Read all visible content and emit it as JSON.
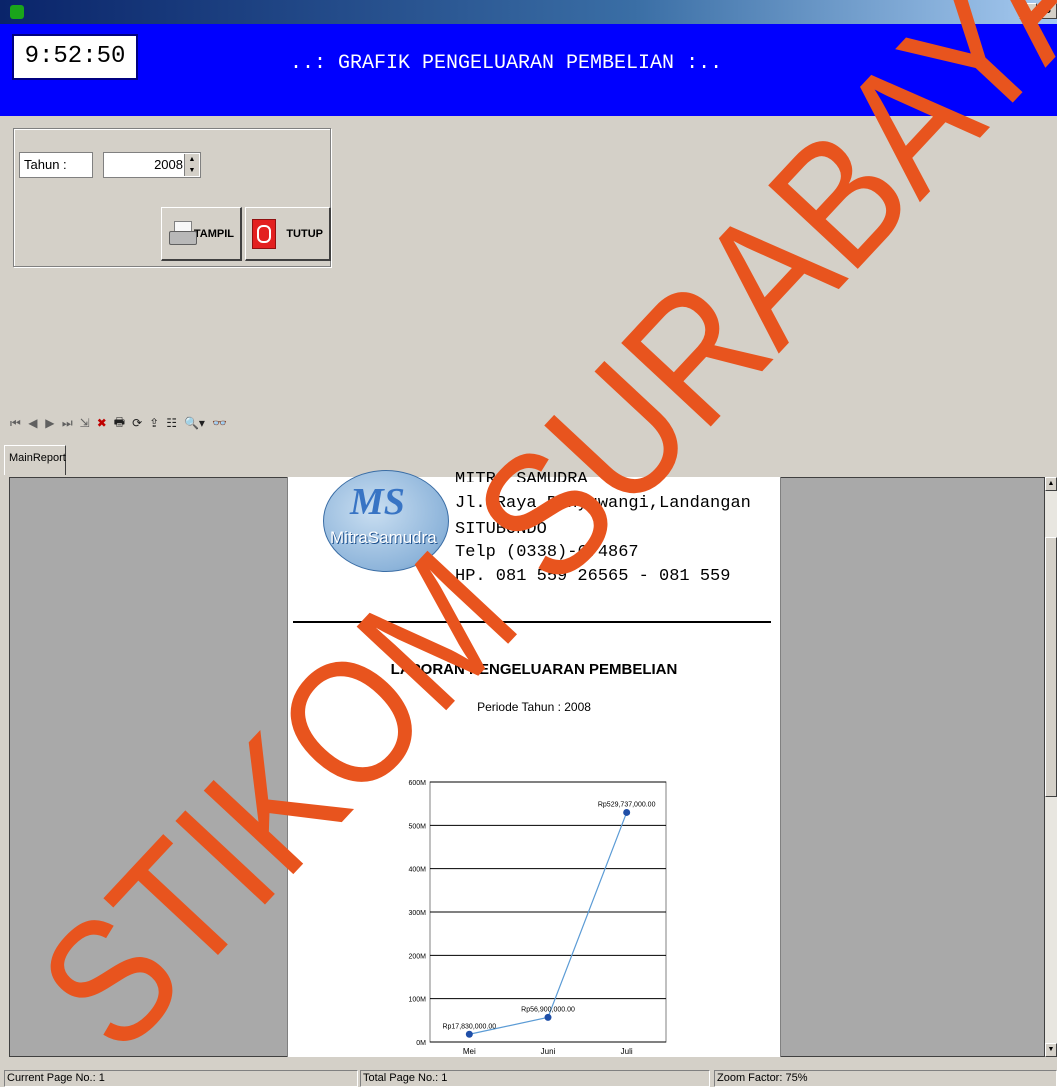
{
  "window": {
    "buttons": [
      "_",
      "8"
    ]
  },
  "header": {
    "clock": "9:52:50",
    "title": "..: GRAFIK PENGELUARAN PEMBELIAN :.."
  },
  "filter": {
    "year_label": "Tahun :",
    "year_value": "2008",
    "show_button": "TAMPIL",
    "close_button": "TUTUP"
  },
  "toolbar": {
    "icons": [
      "first-page-icon",
      "prev-page-icon",
      "next-page-icon",
      "last-page-icon",
      "goto-page-icon",
      "close-view-icon",
      "print-icon",
      "refresh-icon",
      "export-icon",
      "group-tree-icon",
      "zoom-icon",
      "search-icon"
    ],
    "glyphs": [
      "⏮",
      "◀",
      "▶",
      "⏭",
      "⇲",
      "✖",
      "🖶",
      "⟳",
      "⇪",
      "☷",
      "🔍▾",
      "👓"
    ]
  },
  "tabs": {
    "main_report": "MainReport"
  },
  "report": {
    "company_name": "MITRA SAMUDRA",
    "address": "Jl. Raya Banyuwangi,Landangan",
    "city": "SITUBONDO",
    "phone": "Telp (0338)-674867",
    "hp": "HP. 081 559 26565 - 081 559",
    "logo_initials": "MS",
    "logo_name": "MitraSamudra",
    "title": "LAPORAN PENGELUARAN PEMBELIAN",
    "period": "Periode Tahun : 2008"
  },
  "chart_data": {
    "type": "line",
    "categories": [
      "Mei",
      "Juni",
      "Juli"
    ],
    "series": [
      {
        "values": [
          17830000,
          56900000,
          529737000
        ]
      }
    ],
    "data_labels": [
      "Rp17,830,000.00",
      "Rp56,900,000.00",
      "Rp529,737,000.00"
    ],
    "y_ticks": [
      "0M",
      "100M",
      "200M",
      "300M",
      "400M",
      "500M",
      "600M"
    ],
    "ylim": [
      0,
      600000000
    ],
    "grid": true,
    "colors": {
      "line": "#5b9bd5",
      "marker": "#1f4fa8"
    }
  },
  "status": {
    "current_page": "Current Page No.: 1",
    "total_page": "Total Page No.: 1",
    "zoom": "Zoom Factor: 75%"
  },
  "watermark": {
    "text": "STIKOM SURABAYA",
    "color": "#e8541e"
  }
}
